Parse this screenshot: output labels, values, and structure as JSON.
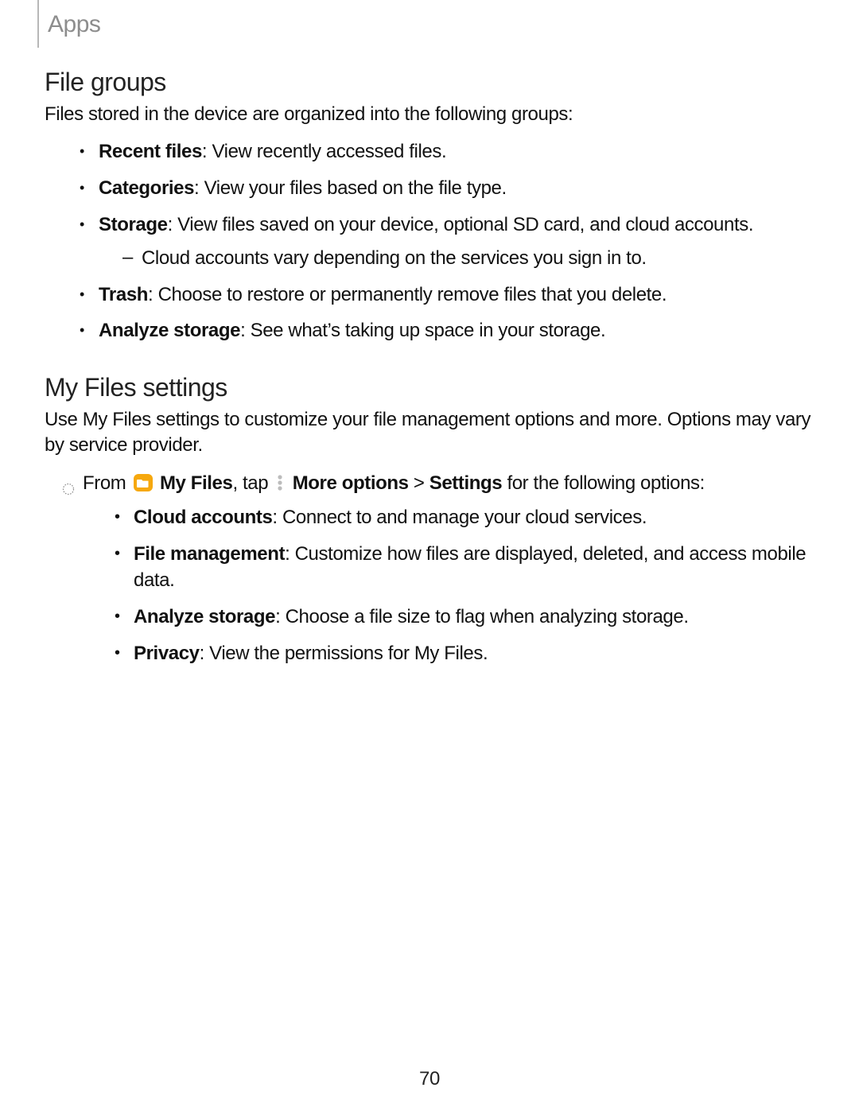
{
  "breadcrumb": "Apps",
  "sec1": {
    "title": "File groups",
    "intro": "Files stored in the device are organized into the following groups:",
    "items": [
      {
        "label": "Recent files",
        "text": ": View recently accessed files."
      },
      {
        "label": "Categories",
        "text": ": View your files based on the file type."
      },
      {
        "label": "Storage",
        "text": ": View files saved on your device, optional SD card, and cloud accounts.",
        "sub": "Cloud accounts vary depending on the services you sign in to."
      },
      {
        "label": "Trash",
        "text": ": Choose to restore or permanently remove files that you delete."
      },
      {
        "label": "Analyze storage",
        "text": ": See what’s taking up space in your storage."
      }
    ]
  },
  "sec2": {
    "title": "My Files settings",
    "intro": "Use My Files settings to customize your file management options and more. Options may vary by service provider.",
    "step": {
      "pre": "From ",
      "app": "My Files",
      "mid": ", tap ",
      "more": "More options",
      "gt": " > ",
      "settings": "Settings",
      "post": " for the following options:"
    },
    "items": [
      {
        "label": "Cloud accounts",
        "text": ": Connect to and manage your cloud services."
      },
      {
        "label": "File management",
        "text": ": Customize how files are displayed, deleted, and access mobile data."
      },
      {
        "label": "Analyze storage",
        "text": ": Choose a file size to flag when analyzing storage."
      },
      {
        "label": "Privacy",
        "text": ": View the permissions for My Files."
      }
    ]
  },
  "page_number": "70"
}
